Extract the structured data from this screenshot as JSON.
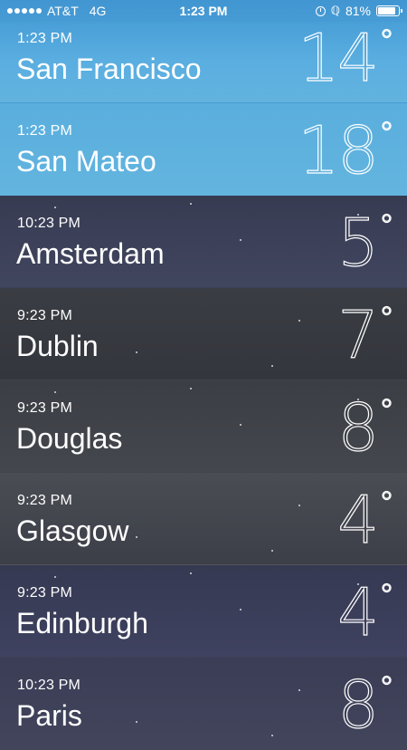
{
  "status_bar": {
    "carrier": "AT&T",
    "network": "4G",
    "time": "1:23 PM",
    "battery": "81%",
    "battery_level": 0.81,
    "alarm_icon": "alarm-icon",
    "bluetooth_icon": "bluetooth-icon"
  },
  "cities": [
    {
      "time": "1:23 PM",
      "name": "San Francisco",
      "temp": "14",
      "bg": "#4fa6d9"
    },
    {
      "time": "1:23 PM",
      "name": "San Mateo",
      "temp": "18",
      "bg": "#5ab0dc"
    },
    {
      "time": "10:23 PM",
      "name": "Amsterdam",
      "temp": "5",
      "bg": "#3b3f55"
    },
    {
      "time": "9:23 PM",
      "name": "Dublin",
      "temp": "7",
      "bg": "#383b40"
    },
    {
      "time": "9:23 PM",
      "name": "Douglas",
      "temp": "8",
      "bg": "#3d4045"
    },
    {
      "time": "9:23 PM",
      "name": "Glasgow",
      "temp": "4",
      "bg": "#42464c"
    },
    {
      "time": "9:23 PM",
      "name": "Edinburgh",
      "temp": "4",
      "bg": "#3a3c55"
    },
    {
      "time": "10:23 PM",
      "name": "Paris",
      "temp": "8",
      "bg": "#3b3e56"
    }
  ]
}
